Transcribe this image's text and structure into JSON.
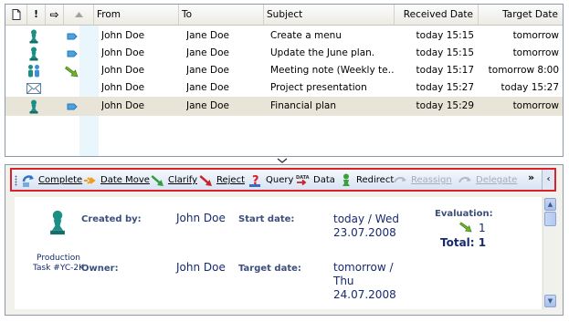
{
  "list": {
    "columns": {
      "type_icon": "page-icon",
      "importance_icon": "exclamation-icon",
      "flag_icon": "arrow-right-icon",
      "sort_icon": "sort-up-icon",
      "from": "From",
      "to": "To",
      "subject": "Subject",
      "received": "Received Date",
      "target": "Target Date"
    },
    "rows": [
      {
        "type_icon": "task-chess-icon",
        "flag_icon": "tag-blue-icon",
        "from": "John Doe",
        "to": "Jane Doe",
        "subject": "Create a menu",
        "received": "today 15:15",
        "target": "tomorrow",
        "selected": false
      },
      {
        "type_icon": "task-chess-icon",
        "flag_icon": "tag-blue-icon",
        "from": "John Doe",
        "to": "Jane Doe",
        "subject": "Update the June plan.",
        "received": "today 15:15",
        "target": "tomorrow",
        "selected": false
      },
      {
        "type_icon": "meeting-people-icon",
        "flag_icon": "arrow-down-green-icon",
        "from": "John Doe",
        "to": "Jane Doe",
        "subject": "Meeting note (Weekly te…",
        "received": "today 15:17",
        "target": "tomorrow 8:00",
        "selected": false
      },
      {
        "type_icon": "envelope-icon",
        "flag_icon": "",
        "from": "John Doe",
        "to": "Jane Doe",
        "subject": "Project presentation",
        "received": "today 15:27",
        "target": "today 15:27",
        "selected": false
      },
      {
        "type_icon": "task-chess-icon",
        "flag_icon": "tag-blue-icon",
        "from": "John Doe",
        "to": "Jane Doe",
        "subject": "Financial plan",
        "received": "today 15:29",
        "target": "tomorrow",
        "selected": true
      }
    ]
  },
  "toolbar": {
    "buttons": [
      {
        "label": "Complete",
        "icon": "complete-icon",
        "enabled": true
      },
      {
        "label": "Date Move",
        "icon": "date-move-icon",
        "enabled": true
      },
      {
        "label": "Clarify",
        "icon": "clarify-icon",
        "enabled": true
      },
      {
        "label": "Reject",
        "icon": "reject-icon",
        "enabled": true
      },
      {
        "label": "Query",
        "icon": "query-icon",
        "enabled": true
      },
      {
        "label": "Data",
        "icon": "data-icon",
        "enabled": true
      },
      {
        "label": "Redirect",
        "icon": "redirect-icon",
        "enabled": true
      },
      {
        "label": "Reassign",
        "icon": "reassign-icon",
        "enabled": false
      },
      {
        "label": "Delegate",
        "icon": "delegate-icon",
        "enabled": false
      }
    ],
    "overflow": "»",
    "collapse": "‹"
  },
  "detail": {
    "task_type": "Production Task #YC-2K",
    "created_by_label": "Created by:",
    "created_by": "John Doe",
    "owner_label": "Owner:",
    "owner": "John Doe",
    "start_date_label": "Start date:",
    "start_date": "today / Wed 23.07.2008",
    "target_date_label": "Target date:",
    "target_date": "tomorrow / Thu 24.07.2008",
    "evaluation_label": "Evaluation:",
    "evaluation_value": "1",
    "total": "Total: 1"
  },
  "colors": {
    "toolbar_border": "#d9222a",
    "label_blue": "#3c4e7c",
    "value_navy": "#172a6e",
    "selected_row": "#e8e5d8"
  }
}
